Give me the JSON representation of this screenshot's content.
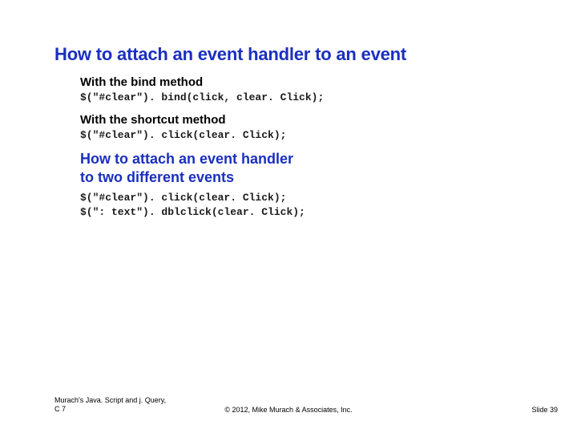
{
  "title": "How to attach an event handler to an event",
  "section1": {
    "sub1": "With the bind method",
    "code1": "$(\"#clear\"). bind(click, clear. Click);",
    "sub2": "With the shortcut method",
    "code2": "$(\"#clear\"). click(clear. Click);"
  },
  "section2": {
    "heading_line1": "How to attach an event handler",
    "heading_line2": "to two different events",
    "code_line1": "$(\"#clear\"). click(clear. Click);",
    "code_line2": "$(\": text\"). dblclick(clear. Click);"
  },
  "footer": {
    "left_line1": "Murach's Java. Script and j. Query,",
    "left_line2": "C 7",
    "center": "© 2012, Mike Murach & Associates, Inc.",
    "right": "Slide 39"
  }
}
